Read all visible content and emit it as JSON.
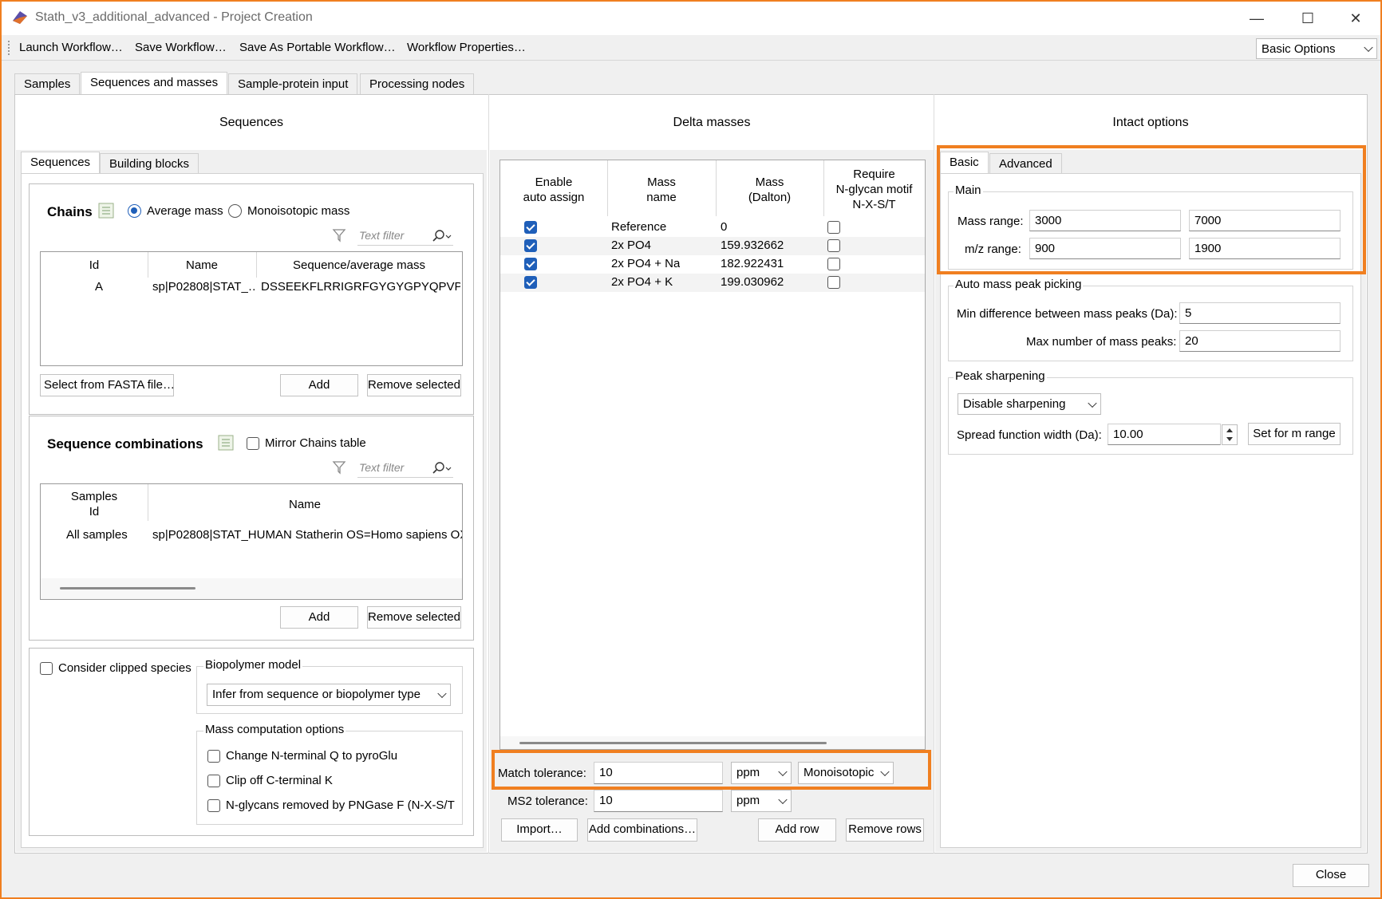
{
  "window": {
    "title": "Stath_v3_additional_advanced - Project Creation",
    "minimize_label": "—",
    "maximize_label": "☐",
    "close_label": "✕"
  },
  "menu": {
    "items": [
      "Launch Workflow…",
      "Save Workflow…",
      "Save As Portable Workflow…",
      "Workflow Properties…"
    ],
    "options_combo": "Basic Options"
  },
  "main_tabs": [
    "Samples",
    "Sequences and masses",
    "Sample-protein input",
    "Processing nodes"
  ],
  "sequences": {
    "header": "Sequences",
    "tabs": [
      "Sequences",
      "Building blocks"
    ],
    "chains": {
      "title": "Chains",
      "radio_average": "Average mass",
      "radio_mono": "Monoisotopic mass",
      "filter_placeholder": "Text filter",
      "columns": [
        "Id",
        "Name",
        "Sequence/average mass"
      ],
      "rows": [
        {
          "id": "A",
          "name": "sp|P02808|STAT_…",
          "seq": "DSSEEKFLRRIGRFGYGYGPYQPVP…"
        }
      ],
      "btn_fasta": "Select from FASTA file…",
      "btn_add": "Add",
      "btn_remove": "Remove selected"
    },
    "combinations": {
      "title": "Sequence combinations",
      "mirror_label": "Mirror Chains table",
      "filter_placeholder": "Text filter",
      "col_samples_1": "Samples",
      "col_samples_2": "Id",
      "col_name": "Name",
      "rows": [
        {
          "samples": "All samples",
          "name": "sp|P02808|STAT_HUMAN Statherin OS=Homo sapiens OX"
        }
      ],
      "btn_add": "Add",
      "btn_remove": "Remove selected"
    },
    "clipped_label": "Consider clipped species",
    "biopolymer_title": "Biopolymer model",
    "biopolymer_value": "Infer from sequence or biopolymer type",
    "mass_options_title": "Mass computation options",
    "mass_options": [
      "Change N-terminal Q to pyroGlu",
      "Clip off C-terminal K",
      "N-glycans removed by PNGase F (N-X-S/T -"
    ]
  },
  "delta": {
    "header": "Delta masses",
    "col_enable_1": "Enable",
    "col_enable_2": "auto assign",
    "col_name_1": "Mass",
    "col_name_2": "name",
    "col_mass_1": "Mass",
    "col_mass_2": "(Dalton)",
    "col_req_1": "Require",
    "col_req_2": "N-glycan motif",
    "col_req_3": "N-X-S/T",
    "rows": [
      {
        "enabled": true,
        "name": "Reference",
        "mass": "0",
        "require": false
      },
      {
        "enabled": true,
        "name": "2x PO4",
        "mass": "159.932662",
        "require": false
      },
      {
        "enabled": true,
        "name": "2x PO4 + Na",
        "mass": "182.922431",
        "require": false
      },
      {
        "enabled": true,
        "name": "2x PO4 + K",
        "mass": "199.030962",
        "require": false
      }
    ],
    "match_label": "Match tolerance:",
    "match_value": "10",
    "match_unit": "ppm",
    "match_mode": "Monoisotopic",
    "ms2_label": "MS2 tolerance:",
    "ms2_value": "10",
    "ms2_unit": "ppm",
    "btn_import": "Import…",
    "btn_add_comb": "Add combinations…",
    "btn_add_row": "Add row",
    "btn_remove_rows": "Remove rows"
  },
  "intact": {
    "header": "Intact options",
    "tabs": [
      "Basic",
      "Advanced"
    ],
    "main_title": "Main",
    "mass_range_label": "Mass range:",
    "mass_range_min": "3000",
    "mass_range_max": "7000",
    "mz_range_label": "m/z range:",
    "mz_min": "900",
    "mz_max": "1900",
    "auto_title": "Auto mass peak picking",
    "min_diff_label": "Min difference between mass peaks (Da):",
    "min_diff_value": "5",
    "max_peaks_label": "Max number of mass peaks:",
    "max_peaks_value": "20",
    "sharpen_title": "Peak sharpening",
    "sharpen_value": "Disable sharpening",
    "spread_label": "Spread function width (Da):",
    "spread_value": "10.00",
    "btn_set_range": "Set for m range"
  },
  "footer": {
    "close_label": "Close"
  },
  "colors": {
    "highlight": "#f07f20",
    "accent": "#1f5fb9"
  }
}
